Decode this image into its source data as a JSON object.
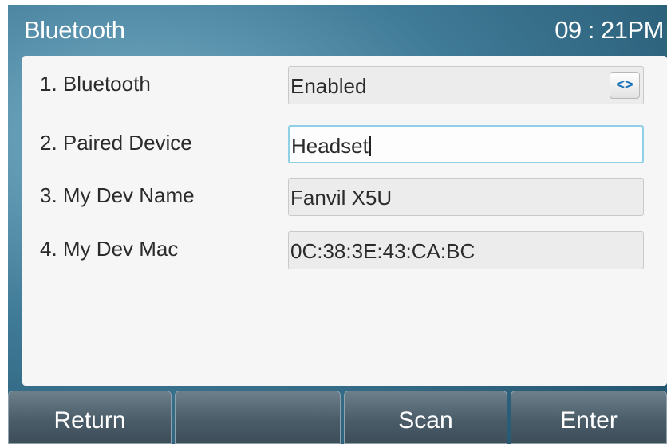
{
  "header": {
    "title": "Bluetooth",
    "time": "09 : 21PM"
  },
  "settings": [
    {
      "label": "1. Bluetooth",
      "value": "Enabled",
      "control": "select"
    },
    {
      "label": "2. Paired Device",
      "value": "Headset",
      "control": "text-input-focused"
    },
    {
      "label": "3. My Dev Name",
      "value": "Fanvil X5U",
      "control": "text"
    },
    {
      "label": "4. My Dev Mac",
      "value": "0C:38:3E:43:CA:BC",
      "control": "text"
    }
  ],
  "select_icon": "<>",
  "softkeys": [
    "Return",
    "",
    "Scan",
    "Enter"
  ],
  "colors": {
    "field_focus_border": "#8fd0e6",
    "select_arrow": "#1a72b8"
  }
}
